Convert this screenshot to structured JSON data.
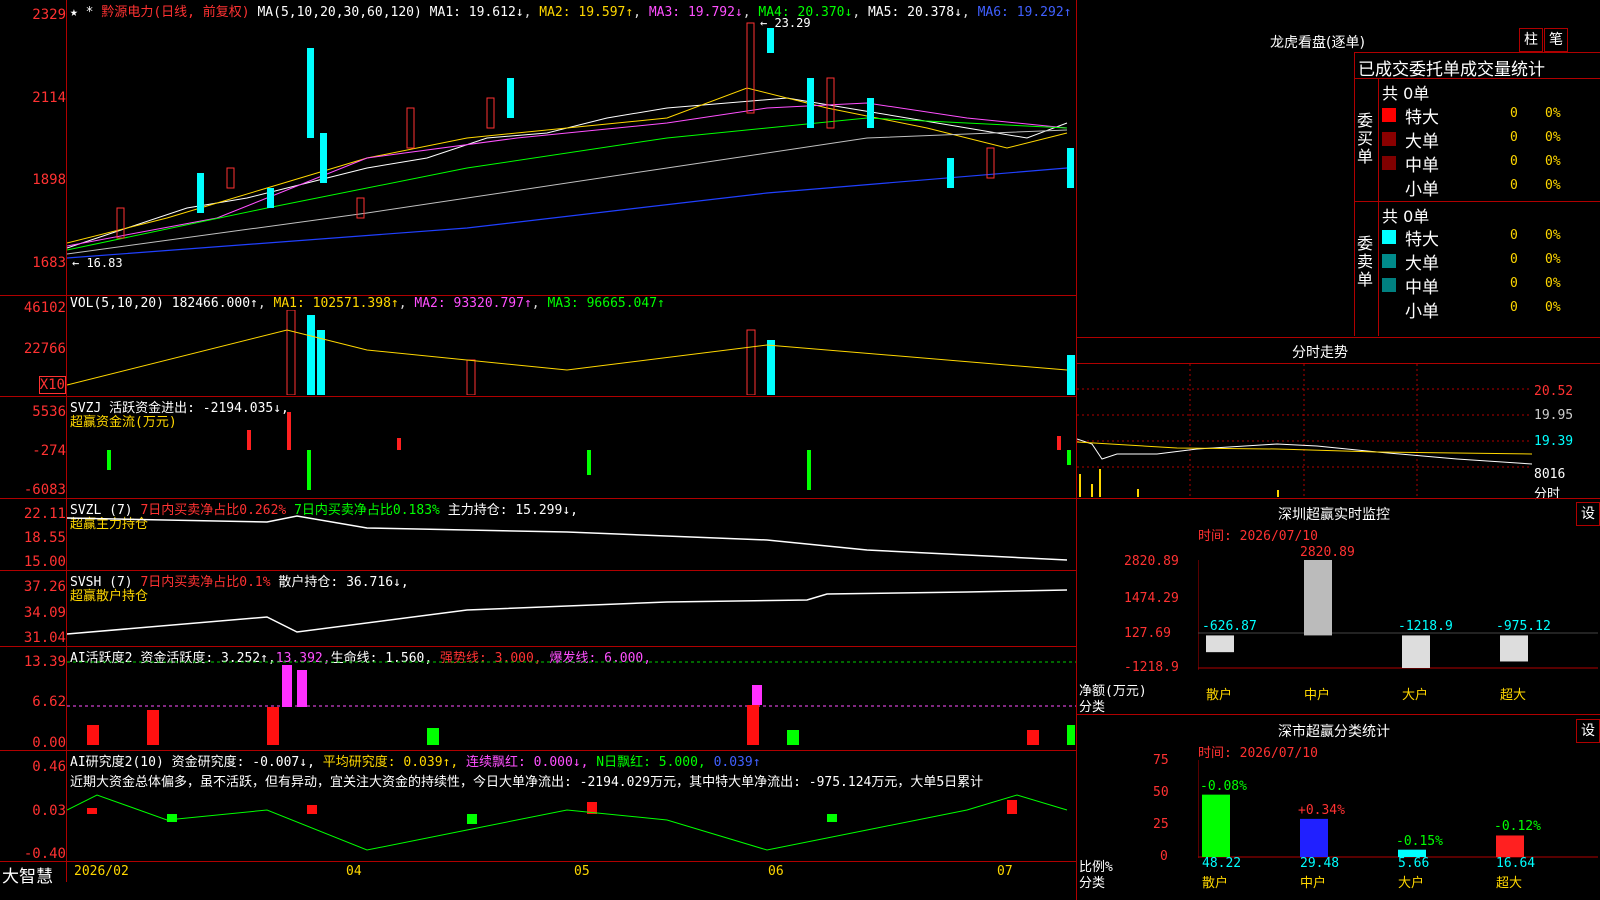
{
  "stock": {
    "name": "黔源电力",
    "mode": "(日线, 前复权)",
    "ma_params": "MA(5,10,20,30,60,120)",
    "ma1": "MA1: 19.612↓",
    "ma2": "MA2: 19.597↑",
    "ma3": "MA3: 19.792↓",
    "ma4": "MA4: 20.370↓",
    "ma5": "MA5: 20.378↓",
    "ma6": "MA6: 19.292↑",
    "high_label": "23.29",
    "low_label": "16.83",
    "yticks": [
      "2329",
      "2114",
      "1898",
      "1683"
    ]
  },
  "vol": {
    "params": "VOL(5,10,20)",
    "val": "182466.000↑",
    "ma1": "MA1: 102571.398↑",
    "ma2": "MA2: 93320.797↑",
    "ma3": "MA3: 96665.047↑",
    "yticks": [
      "46102",
      "22766",
      "X10"
    ]
  },
  "svzj": {
    "title": "SVZJ",
    "desc": "活跃资金进出: -2194.035↓,",
    "sub": "超赢资金流(万元)",
    "yticks": [
      "5536",
      "-274",
      "-6083"
    ]
  },
  "svzl": {
    "title": "SVZL (7)",
    "a": "7日内买卖净占比0.262%",
    "b": "7日内买卖净占比0.183%",
    "c": "主力持仓: 15.299↓,",
    "sub": "超赢主力持仓",
    "yticks": [
      "22.11",
      "18.55",
      "15.00"
    ]
  },
  "svsh": {
    "title": "SVSH (7)",
    "a": "7日内买卖净占比0.1%",
    "c": "散户持仓: 36.716↓,",
    "sub": "超赢散户持仓",
    "yticks": [
      "37.26",
      "34.09",
      "31.04"
    ]
  },
  "ai1": {
    "title": "AI活跃度2",
    "a": "资金活跃度: 3.252↑,",
    "b": "13.392,",
    "c": "生命线: 1.560,",
    "d": "强势线: 3.000,",
    "e": "爆发线: 6.000,",
    "yticks": [
      "13.39",
      "6.62",
      "0.00"
    ]
  },
  "ai2": {
    "title": "AI研究度2(10)",
    "a": "资金研究度: -0.007↓,",
    "b": "平均研究度: 0.039↑,",
    "c": "连续飘红: 0.000↓,",
    "d": "N日飘红: 5.000,",
    "e": "0.039↑",
    "text": "近期大资金总体偏多，虽不活跃，但有异动，宜关注大资金的持续性，今日大单净流出: -2194.029万元，其中特大单净流出: -975.124万元，大单5日累计",
    "yticks": [
      "0.46",
      "0.03",
      "-0.40"
    ]
  },
  "xaxis": {
    "labels": [
      "2026/02",
      "04",
      "05",
      "06",
      "07"
    ],
    "brand": "大智慧"
  },
  "lhb": {
    "title": "龙虎看盘(逐单)",
    "btn1": "柱",
    "btn2": "笔",
    "subtitle": "已成交委托单成交量统计",
    "buy_label": "委买单",
    "sell_label": "委卖单",
    "buy_total": "共 0单",
    "sell_total": "共 0单",
    "rows": [
      "特大",
      "大单",
      "中单",
      "小单"
    ],
    "zero": "0",
    "pct": "0%",
    "buy_colors": [
      "#ff0000",
      "#8b0000",
      "#800000",
      "#000000"
    ],
    "sell_colors": [
      "#00ffff",
      "#008b8b",
      "#008080",
      "#000000"
    ]
  },
  "fenshi": {
    "title": "分时走势",
    "yticks": [
      "20.52",
      "19.95",
      "19.39",
      "8016",
      "分时"
    ]
  },
  "szjk": {
    "title": "深圳超赢实时监控",
    "btn": "设",
    "time": "时间: 2026/07/10",
    "yticks": [
      "2820.89",
      "1474.29",
      "127.69",
      "-1218.9"
    ],
    "bars": [
      {
        "cat": "散户",
        "val": "-626.87"
      },
      {
        "cat": "中户",
        "val": "2820.89"
      },
      {
        "cat": "大户",
        "val": "-1218.9"
      },
      {
        "cat": "超大",
        "val": "-975.12"
      }
    ],
    "ylab": "净额(万元)",
    "xlab": "分类"
  },
  "szfl": {
    "title": "深市超赢分类统计",
    "btn": "设",
    "time": "时间: 2026/07/10",
    "yticks": [
      "75",
      "50",
      "25",
      "0"
    ],
    "bars": [
      {
        "cat": "散户",
        "val": "48.22",
        "chg": "-0.08%"
      },
      {
        "cat": "中户",
        "val": "29.48",
        "chg": "+0.34%"
      },
      {
        "cat": "大户",
        "val": "5.66",
        "chg": "-0.15%"
      },
      {
        "cat": "超大",
        "val": "16.64",
        "chg": "-0.12%"
      }
    ],
    "ylab": "比例%",
    "xlab": "分类"
  }
}
